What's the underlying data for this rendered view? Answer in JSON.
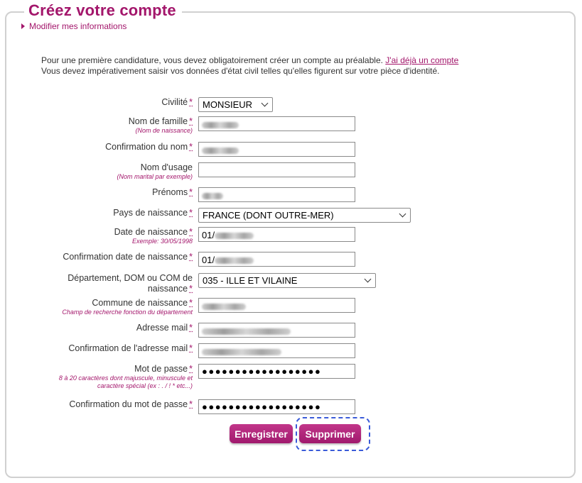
{
  "title": "Créez votre compte",
  "modify_link": "Modifier mes informations",
  "intro": {
    "line1": "Pour une première candidature, vous devez obligatoirement créer un compte au préalable.",
    "link": "J'ai déjà un compte",
    "line2": "Vous devez impérativement saisir vos données d'état civil telles qu'elles figurent sur votre pièce d'identité."
  },
  "required_mark": "*",
  "form": {
    "civilite": {
      "label": "Civilité",
      "value": "MONSIEUR"
    },
    "nom_famille": {
      "label": "Nom de famille",
      "hint": "(Nom de naissance)"
    },
    "confirm_nom": {
      "label": "Confirmation du nom"
    },
    "nom_usage": {
      "label": "Nom d'usage",
      "hint": "(Nom marital par exemple)",
      "value": ""
    },
    "prenoms": {
      "label": "Prénoms"
    },
    "pays": {
      "label": "Pays de naissance",
      "value": "FRANCE (DONT OUTRE-MER)"
    },
    "date_naissance": {
      "label": "Date de naissance",
      "hint": "Exemple: 30/05/1998",
      "value_prefix": "01/"
    },
    "confirm_date": {
      "label": "Confirmation date de naissance",
      "value_prefix": "01/"
    },
    "departement": {
      "label_line1": "Département, DOM ou COM de",
      "label_line2": "naissance",
      "value": "035 - ILLE ET VILAINE"
    },
    "commune": {
      "label": "Commune de naissance",
      "hint": "Champ de recherche fonction du département"
    },
    "email": {
      "label": "Adresse mail"
    },
    "confirm_email": {
      "label": "Confirmation de l'adresse mail"
    },
    "password": {
      "label": "Mot de passe",
      "hint_line1": "8 à 20 caractères dont majuscule, minuscule et",
      "hint_line2": "caractère spécial (ex : . / ! * etc...)",
      "masked": "●●●●●●●●●●●●●●●●●●"
    },
    "confirm_password": {
      "label": "Confirmation du mot de passe",
      "masked": "●●●●●●●●●●●●●●●●●●"
    }
  },
  "buttons": {
    "save": "Enregistrer",
    "delete": "Supprimer"
  },
  "colors": {
    "accent": "#a3166b",
    "highlight": "#3a5bd9"
  }
}
